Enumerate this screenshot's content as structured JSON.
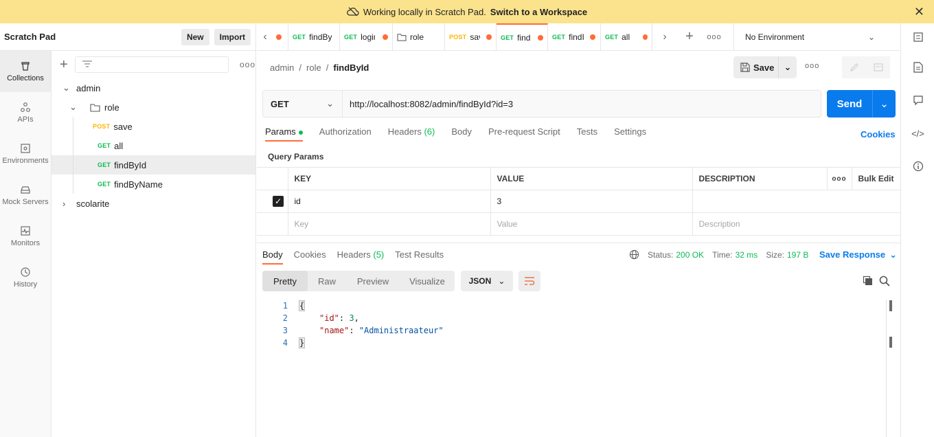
{
  "banner": {
    "text": "Working locally in Scratch Pad.",
    "link": "Switch to a Workspace"
  },
  "sidebar_header": {
    "title": "Scratch Pad",
    "new_label": "New",
    "import_label": "Import"
  },
  "rail": [
    {
      "label": "Collections",
      "icon": "collections-icon"
    },
    {
      "label": "APIs",
      "icon": "apis-icon"
    },
    {
      "label": "Environments",
      "icon": "environments-icon"
    },
    {
      "label": "Mock Servers",
      "icon": "mock-servers-icon"
    },
    {
      "label": "Monitors",
      "icon": "monitors-icon"
    },
    {
      "label": "History",
      "icon": "history-icon"
    }
  ],
  "tree": {
    "collection1": "admin",
    "folder": "role",
    "requests": [
      {
        "method": "POST",
        "name": "save"
      },
      {
        "method": "GET",
        "name": "all"
      },
      {
        "method": "GET",
        "name": "findById"
      },
      {
        "method": "GET",
        "name": "findByName"
      }
    ],
    "collection2": "scolarite"
  },
  "tabs": [
    {
      "method": "GET",
      "name": "findBy"
    },
    {
      "method": "GET",
      "name": "login"
    },
    {
      "method": "",
      "name": "role"
    },
    {
      "method": "POST",
      "name": "sav"
    },
    {
      "method": "GET",
      "name": "find"
    },
    {
      "method": "GET",
      "name": "findI"
    },
    {
      "method": "GET",
      "name": "all"
    }
  ],
  "environment": "No Environment",
  "breadcrumb": {
    "part1": "admin",
    "part2": "role",
    "current": "findById",
    "sep": "/"
  },
  "save_label": "Save",
  "request": {
    "method": "GET",
    "url": "http://localhost:8082/admin/findById?id=3",
    "send_label": "Send"
  },
  "req_tabs": {
    "params": "Params",
    "authorization": "Authorization",
    "headers": "Headers",
    "headers_count": "(6)",
    "body": "Body",
    "prerequest": "Pre-request Script",
    "tests": "Tests",
    "settings": "Settings",
    "cookies": "Cookies"
  },
  "query_params": {
    "title": "Query Params",
    "col_key": "KEY",
    "col_value": "VALUE",
    "col_description": "DESCRIPTION",
    "bulk_edit": "Bulk Edit",
    "row_key": "id",
    "row_value": "3",
    "ph_key": "Key",
    "ph_value": "Value",
    "ph_description": "Description"
  },
  "response": {
    "tabs": {
      "body": "Body",
      "cookies": "Cookies",
      "headers": "Headers",
      "headers_count": "(5)",
      "tests": "Test Results"
    },
    "status_label": "Status:",
    "status_value": "200 OK",
    "time_label": "Time:",
    "time_value": "32 ms",
    "size_label": "Size:",
    "size_value": "197 B",
    "save_response": "Save Response",
    "format_tabs": {
      "pretty": "Pretty",
      "raw": "Raw",
      "preview": "Preview",
      "visualize": "Visualize"
    },
    "format": "JSON",
    "lines": {
      "n1": "1",
      "n2": "2",
      "n3": "3",
      "n4": "4",
      "open": "{",
      "key1": "\"id\"",
      "val1": "3",
      "key2": "\"name\"",
      "val2": "\"Administraateur\"",
      "close": "}"
    }
  }
}
